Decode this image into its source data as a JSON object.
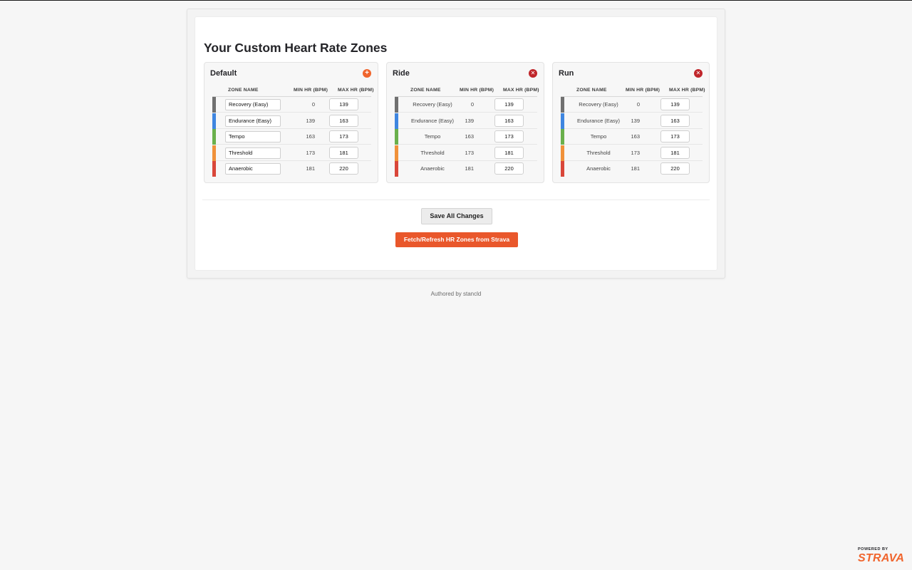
{
  "page": {
    "title": "Your Custom Heart Rate Zones"
  },
  "table_headers": {
    "zone_name": "ZONE NAME",
    "min_hr": "MIN HR (BPM)",
    "max_hr": "MAX HR (BPM)"
  },
  "cards": [
    {
      "title": "Default",
      "action_icon": "add-icon",
      "editable_names": true,
      "zones": [
        {
          "name": "Recovery (Easy)",
          "min": "0",
          "max": "139",
          "color": "#707070"
        },
        {
          "name": "Endurance (Easy)",
          "min": "139",
          "max": "163",
          "color": "#3f86e0"
        },
        {
          "name": "Tempo",
          "min": "163",
          "max": "173",
          "color": "#6ab04c"
        },
        {
          "name": "Threshold",
          "min": "173",
          "max": "181",
          "color": "#f0913a"
        },
        {
          "name": "Anaerobic",
          "min": "181",
          "max": "220",
          "color": "#d9473a"
        }
      ]
    },
    {
      "title": "Ride",
      "action_icon": "delete-icon",
      "editable_names": false,
      "zones": [
        {
          "name": "Recovery (Easy)",
          "min": "0",
          "max": "139",
          "color": "#707070"
        },
        {
          "name": "Endurance (Easy)",
          "min": "139",
          "max": "163",
          "color": "#3f86e0"
        },
        {
          "name": "Tempo",
          "min": "163",
          "max": "173",
          "color": "#6ab04c"
        },
        {
          "name": "Threshold",
          "min": "173",
          "max": "181",
          "color": "#f0913a"
        },
        {
          "name": "Anaerobic",
          "min": "181",
          "max": "220",
          "color": "#d9473a"
        }
      ]
    },
    {
      "title": "Run",
      "action_icon": "delete-icon",
      "editable_names": false,
      "zones": [
        {
          "name": "Recovery (Easy)",
          "min": "0",
          "max": "139",
          "color": "#707070"
        },
        {
          "name": "Endurance (Easy)",
          "min": "139",
          "max": "163",
          "color": "#3f86e0"
        },
        {
          "name": "Tempo",
          "min": "163",
          "max": "173",
          "color": "#6ab04c"
        },
        {
          "name": "Threshold",
          "min": "173",
          "max": "181",
          "color": "#f0913a"
        },
        {
          "name": "Anaerobic",
          "min": "181",
          "max": "220",
          "color": "#d9473a"
        }
      ]
    }
  ],
  "actions": {
    "save_label": "Save All Changes",
    "fetch_label": "Fetch/Refresh HR Zones from Strava"
  },
  "footer": {
    "text": "Authored by stancld"
  },
  "branding": {
    "powered_by": "POWERED BY",
    "strava": "STRAVA",
    "accent": "#f0652d"
  }
}
